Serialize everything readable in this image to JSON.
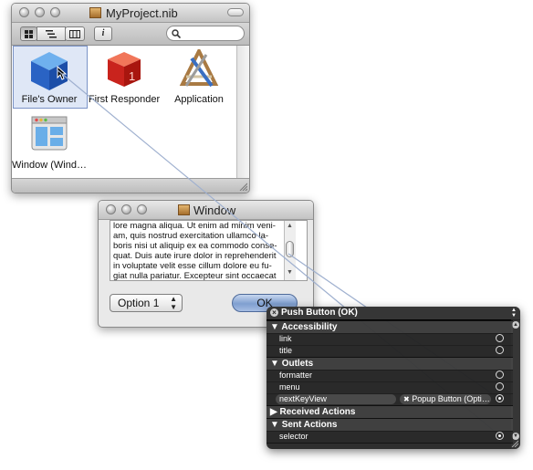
{
  "nib_window": {
    "title": "MyProject.nib",
    "toolbar": {
      "view_modes": [
        "icon-view",
        "list-view",
        "column-view"
      ],
      "info_button": "i",
      "search_placeholder": ""
    },
    "items": [
      {
        "label": "File's Owner",
        "icon": "cube-icon",
        "selected": true
      },
      {
        "label": "First Responder",
        "icon": "first-responder-icon",
        "selected": false
      },
      {
        "label": "Application",
        "icon": "application-icon",
        "selected": false
      },
      {
        "label": "Window (Wind…",
        "icon": "window-icon",
        "selected": false
      }
    ]
  },
  "preview_window": {
    "title": "Window",
    "text_lines": [
      "lore magna aliqua. Ut enim ad minim veni-",
      "am, quis nostrud exercitation ullamco la-",
      "boris nisi ut aliquip ex ea commodo conse-",
      "quat. Duis aute irure dolor in reprehenderit",
      "in voluptate velit esse cillum dolore eu fu-",
      "giat nulla pariatur. Excepteur sint occaecat"
    ],
    "popup_value": "Option 1",
    "ok_label": "OK"
  },
  "hud": {
    "title": "Push Button (OK)",
    "rows": [
      {
        "kind": "category",
        "label": "Accessibility",
        "expanded": true
      },
      {
        "kind": "outlet",
        "label": "link",
        "connected": false
      },
      {
        "kind": "outlet",
        "label": "title",
        "connected": false
      },
      {
        "kind": "category",
        "label": "Outlets",
        "expanded": true
      },
      {
        "kind": "outlet",
        "label": "formatter",
        "connected": false
      },
      {
        "kind": "outlet",
        "label": "menu",
        "connected": false
      },
      {
        "kind": "outlet",
        "label": "nextKeyView",
        "connected": true,
        "target": "Popup Button (Opti…"
      },
      {
        "kind": "category",
        "label": "Received Actions",
        "expanded": false
      },
      {
        "kind": "category",
        "label": "Sent Actions",
        "expanded": true
      },
      {
        "kind": "outlet",
        "label": "selector",
        "connected": true
      }
    ]
  },
  "colors": {
    "connection_line": "#8fa4c8",
    "selection": "#dfe7f6",
    "hud_background": "#1e1e1e",
    "ok_button": "#7f9fd0"
  }
}
